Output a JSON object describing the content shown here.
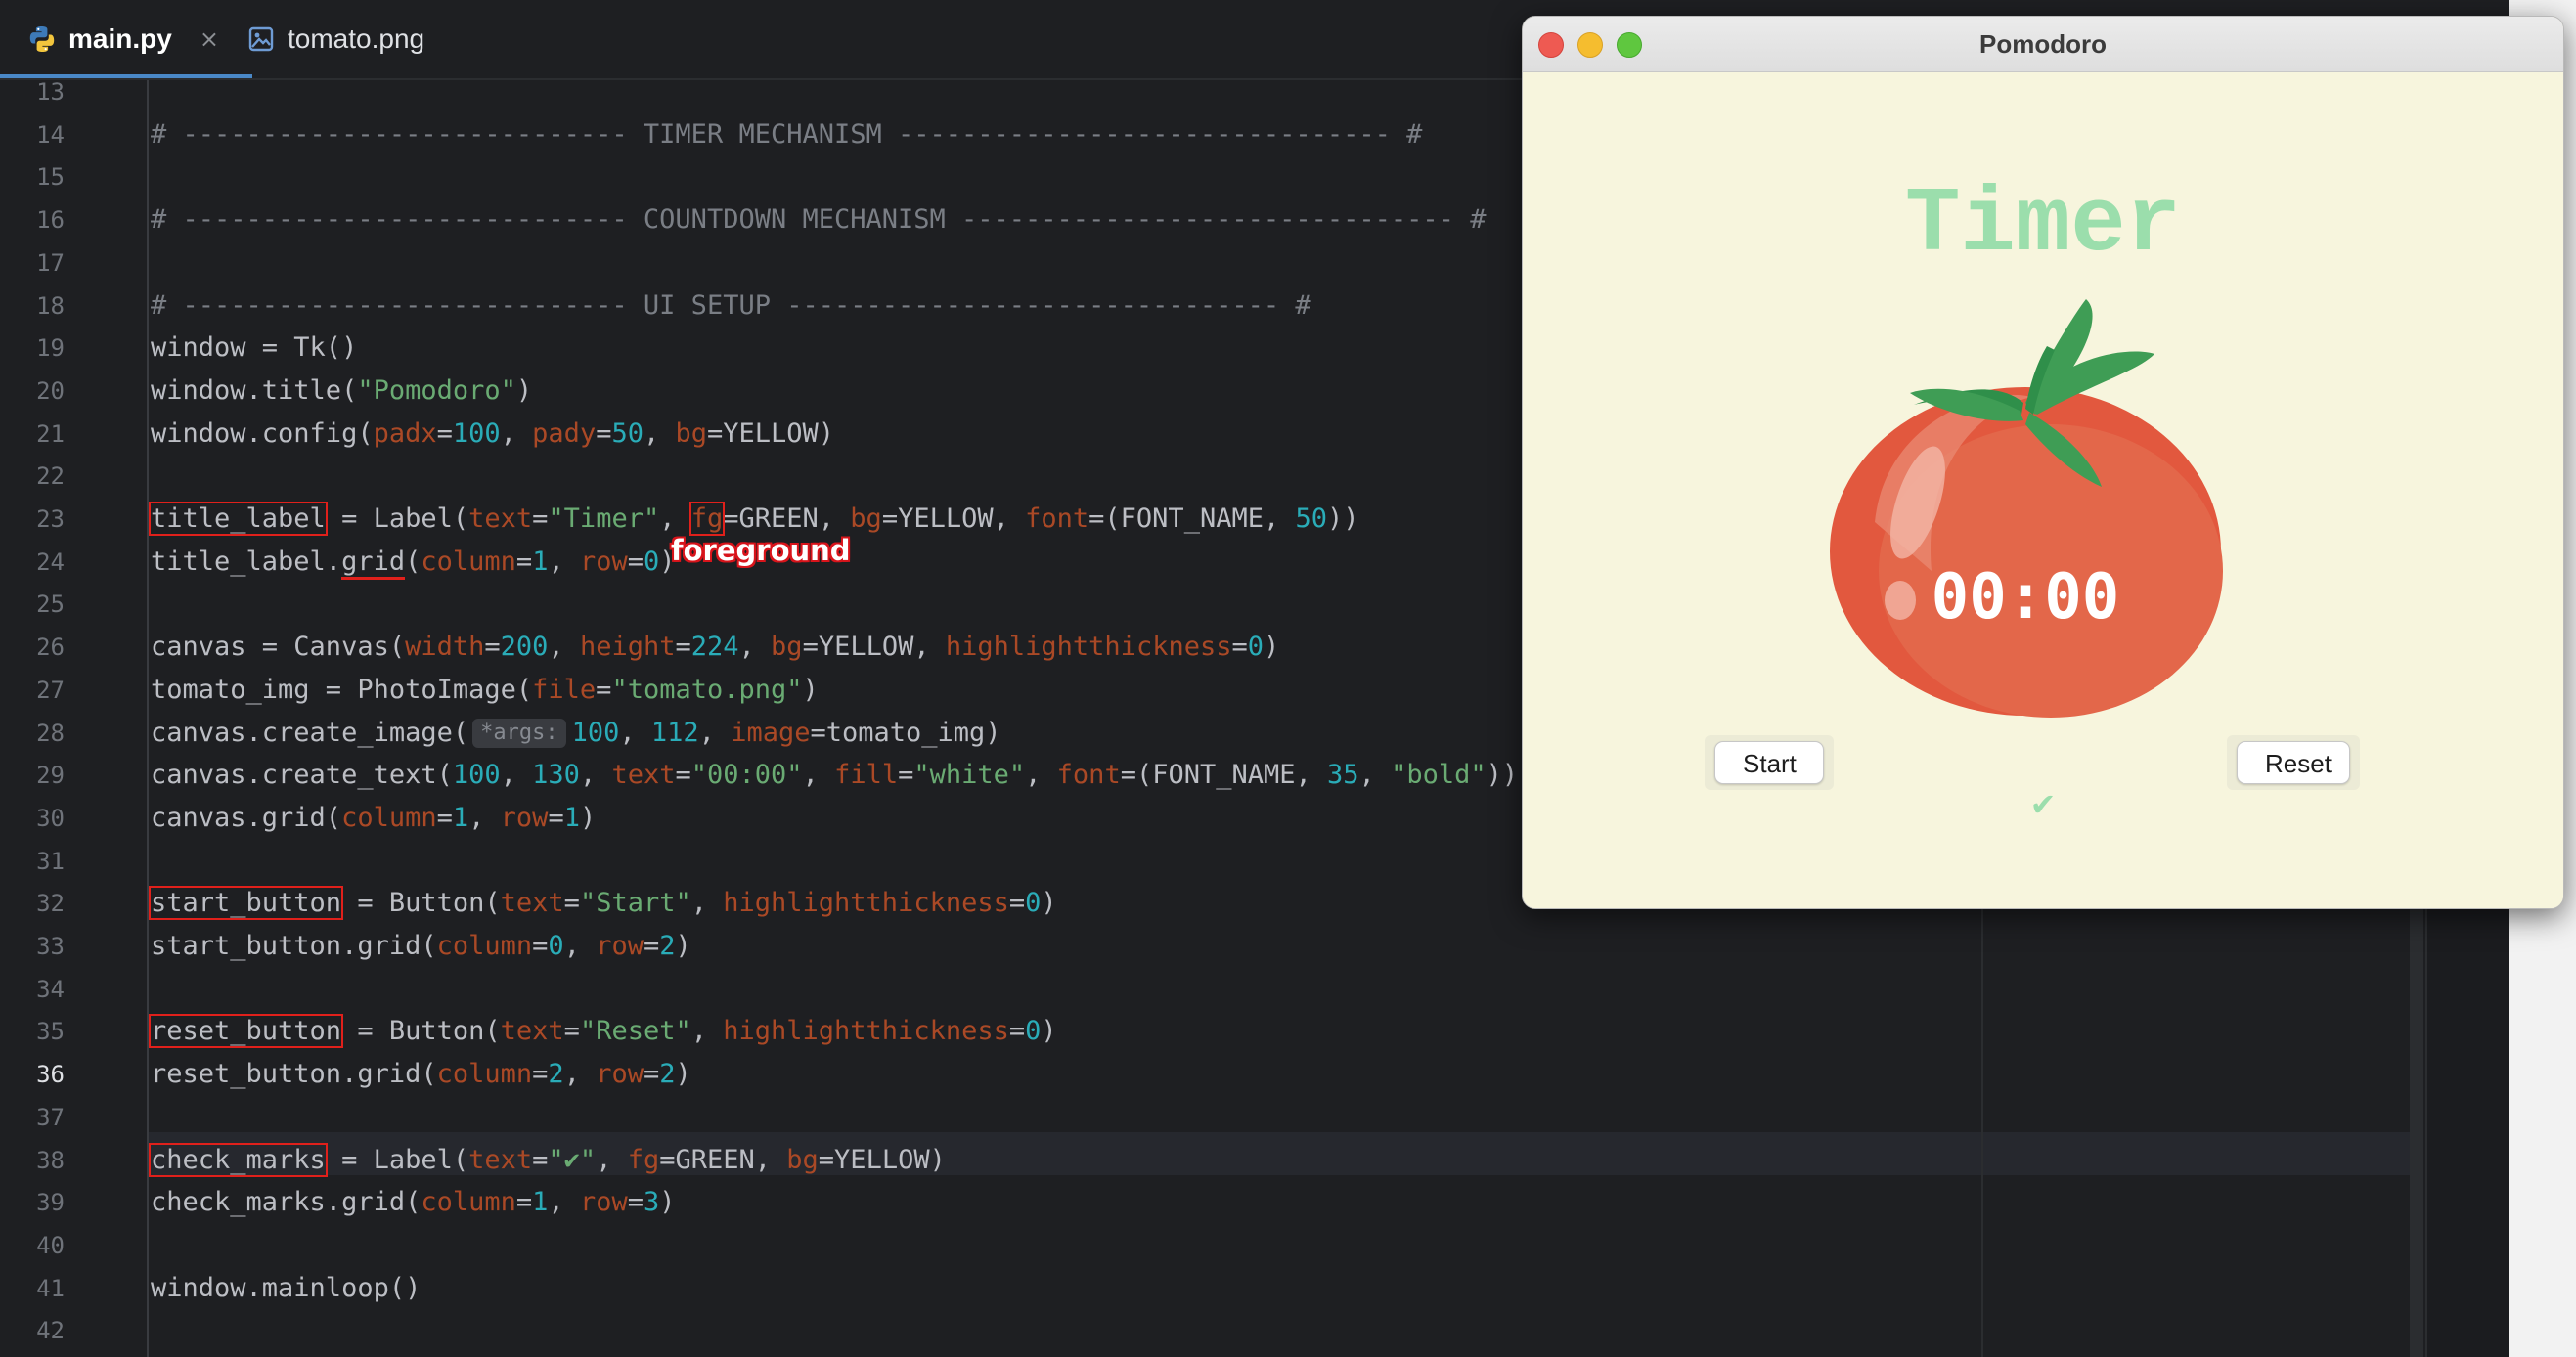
{
  "tabs": [
    {
      "label": "main.py",
      "icon": "python-icon",
      "active": true,
      "close": "×"
    },
    {
      "label": "tomato.png",
      "icon": "image-icon",
      "active": false
    }
  ],
  "editor": {
    "current_line": "36",
    "annotation": "foreground",
    "lines": [
      {
        "n": "13",
        "tokens": []
      },
      {
        "n": "14",
        "tokens": [
          {
            "t": "# ---------------------------- TIMER MECHANISM ------------------------------- #",
            "c": "com"
          }
        ]
      },
      {
        "n": "15",
        "tokens": []
      },
      {
        "n": "16",
        "tokens": [
          {
            "t": "# ---------------------------- COUNTDOWN MECHANISM ------------------------------- #",
            "c": "com"
          }
        ]
      },
      {
        "n": "17",
        "tokens": []
      },
      {
        "n": "18",
        "tokens": [
          {
            "t": "# ---------------------------- UI SETUP ------------------------------- #",
            "c": "com"
          }
        ]
      },
      {
        "n": "19",
        "tokens": [
          {
            "t": "window = Tk()"
          }
        ]
      },
      {
        "n": "20",
        "tokens": [
          {
            "t": "window.title("
          },
          {
            "t": "\"Pomodoro\"",
            "c": "str"
          },
          {
            "t": ")"
          }
        ]
      },
      {
        "n": "21",
        "tokens": [
          {
            "t": "window.config("
          },
          {
            "t": "padx",
            "c": "par"
          },
          {
            "t": "="
          },
          {
            "t": "100",
            "c": "num"
          },
          {
            "t": ", "
          },
          {
            "t": "pady",
            "c": "par"
          },
          {
            "t": "="
          },
          {
            "t": "50",
            "c": "num"
          },
          {
            "t": ", "
          },
          {
            "t": "bg",
            "c": "par"
          },
          {
            "t": "=YELLOW)"
          }
        ]
      },
      {
        "n": "22",
        "tokens": []
      },
      {
        "n": "23",
        "tokens": [
          {
            "t": "title_label",
            "c": "box"
          },
          {
            "t": " = Label("
          },
          {
            "t": "text",
            "c": "par"
          },
          {
            "t": "="
          },
          {
            "t": "\"Timer\"",
            "c": "str"
          },
          {
            "t": ", "
          },
          {
            "t": "fg",
            "c": "par box"
          },
          {
            "t": "=GREEN, "
          },
          {
            "t": "bg",
            "c": "par"
          },
          {
            "t": "=YELLOW, "
          },
          {
            "t": "font",
            "c": "par"
          },
          {
            "t": "=(FONT_NAME, "
          },
          {
            "t": "50",
            "c": "num"
          },
          {
            "t": "))"
          }
        ]
      },
      {
        "n": "24",
        "tokens": [
          {
            "t": "title_label."
          },
          {
            "t": "grid",
            "c": "under"
          },
          {
            "t": "("
          },
          {
            "t": "column",
            "c": "par"
          },
          {
            "t": "="
          },
          {
            "t": "1",
            "c": "num"
          },
          {
            "t": ", "
          },
          {
            "t": "row",
            "c": "par"
          },
          {
            "t": "="
          },
          {
            "t": "0",
            "c": "num"
          },
          {
            "t": ")"
          }
        ]
      },
      {
        "n": "25",
        "tokens": []
      },
      {
        "n": "26",
        "tokens": [
          {
            "t": "canvas = Canvas("
          },
          {
            "t": "width",
            "c": "par"
          },
          {
            "t": "="
          },
          {
            "t": "200",
            "c": "num"
          },
          {
            "t": ", "
          },
          {
            "t": "height",
            "c": "par"
          },
          {
            "t": "="
          },
          {
            "t": "224",
            "c": "num"
          },
          {
            "t": ", "
          },
          {
            "t": "bg",
            "c": "par"
          },
          {
            "t": "=YELLOW, "
          },
          {
            "t": "highlightthickness",
            "c": "par"
          },
          {
            "t": "="
          },
          {
            "t": "0",
            "c": "num"
          },
          {
            "t": ")"
          }
        ]
      },
      {
        "n": "27",
        "tokens": [
          {
            "t": "tomato_img = PhotoImage("
          },
          {
            "t": "file",
            "c": "par"
          },
          {
            "t": "="
          },
          {
            "t": "\"tomato.png\"",
            "c": "str"
          },
          {
            "t": ")"
          }
        ]
      },
      {
        "n": "28",
        "tokens": [
          {
            "t": "canvas.create_image("
          },
          {
            "t": "*args:",
            "c": "hint"
          },
          {
            "t": "100",
            "c": "num"
          },
          {
            "t": ", "
          },
          {
            "t": "112",
            "c": "num"
          },
          {
            "t": ", "
          },
          {
            "t": "image",
            "c": "par"
          },
          {
            "t": "=tomato_img)"
          }
        ]
      },
      {
        "n": "29",
        "tokens": [
          {
            "t": "canvas.create_text("
          },
          {
            "t": "100",
            "c": "num"
          },
          {
            "t": ", "
          },
          {
            "t": "130",
            "c": "num"
          },
          {
            "t": ", "
          },
          {
            "t": "text",
            "c": "par"
          },
          {
            "t": "="
          },
          {
            "t": "\"00:00\"",
            "c": "str"
          },
          {
            "t": ", "
          },
          {
            "t": "fill",
            "c": "par"
          },
          {
            "t": "="
          },
          {
            "t": "\"white\"",
            "c": "str"
          },
          {
            "t": ", "
          },
          {
            "t": "font",
            "c": "par"
          },
          {
            "t": "=(FONT_NAME, "
          },
          {
            "t": "35",
            "c": "num"
          },
          {
            "t": ", "
          },
          {
            "t": "\"bold\"",
            "c": "str"
          },
          {
            "t": "))"
          }
        ]
      },
      {
        "n": "30",
        "tokens": [
          {
            "t": "canvas.grid("
          },
          {
            "t": "column",
            "c": "par"
          },
          {
            "t": "="
          },
          {
            "t": "1",
            "c": "num"
          },
          {
            "t": ", "
          },
          {
            "t": "row",
            "c": "par"
          },
          {
            "t": "="
          },
          {
            "t": "1",
            "c": "num"
          },
          {
            "t": ")"
          }
        ]
      },
      {
        "n": "31",
        "tokens": []
      },
      {
        "n": "32",
        "tokens": [
          {
            "t": "start_button",
            "c": "box"
          },
          {
            "t": " = Button("
          },
          {
            "t": "text",
            "c": "par"
          },
          {
            "t": "="
          },
          {
            "t": "\"Start\"",
            "c": "str"
          },
          {
            "t": ", "
          },
          {
            "t": "highlightthickness",
            "c": "par"
          },
          {
            "t": "="
          },
          {
            "t": "0",
            "c": "num"
          },
          {
            "t": ")"
          }
        ]
      },
      {
        "n": "33",
        "tokens": [
          {
            "t": "start_button.grid("
          },
          {
            "t": "column",
            "c": "par"
          },
          {
            "t": "="
          },
          {
            "t": "0",
            "c": "num"
          },
          {
            "t": ", "
          },
          {
            "t": "row",
            "c": "par"
          },
          {
            "t": "="
          },
          {
            "t": "2",
            "c": "num"
          },
          {
            "t": ")"
          }
        ]
      },
      {
        "n": "34",
        "tokens": []
      },
      {
        "n": "35",
        "tokens": [
          {
            "t": "reset_button",
            "c": "box"
          },
          {
            "t": " = Button("
          },
          {
            "t": "text",
            "c": "par"
          },
          {
            "t": "="
          },
          {
            "t": "\"Reset\"",
            "c": "str"
          },
          {
            "t": ", "
          },
          {
            "t": "highlightthickness",
            "c": "par"
          },
          {
            "t": "="
          },
          {
            "t": "0",
            "c": "num"
          },
          {
            "t": ")"
          }
        ]
      },
      {
        "n": "36",
        "tokens": [
          {
            "t": "reset_button.grid("
          },
          {
            "t": "column",
            "c": "par"
          },
          {
            "t": "="
          },
          {
            "t": "2",
            "c": "num"
          },
          {
            "t": ", "
          },
          {
            "t": "row",
            "c": "par"
          },
          {
            "t": "="
          },
          {
            "t": "2",
            "c": "num"
          },
          {
            "t": ")"
          }
        ]
      },
      {
        "n": "37",
        "tokens": []
      },
      {
        "n": "38",
        "tokens": [
          {
            "t": "check_marks",
            "c": "box"
          },
          {
            "t": " = Label("
          },
          {
            "t": "text",
            "c": "par"
          },
          {
            "t": "="
          },
          {
            "t": "\"✔\"",
            "c": "str"
          },
          {
            "t": ", "
          },
          {
            "t": "fg",
            "c": "par"
          },
          {
            "t": "=GREEN, "
          },
          {
            "t": "bg",
            "c": "par"
          },
          {
            "t": "=YELLOW)"
          }
        ]
      },
      {
        "n": "39",
        "tokens": [
          {
            "t": "check_marks.grid("
          },
          {
            "t": "column",
            "c": "par"
          },
          {
            "t": "="
          },
          {
            "t": "1",
            "c": "num"
          },
          {
            "t": ", "
          },
          {
            "t": "row",
            "c": "par"
          },
          {
            "t": "="
          },
          {
            "t": "3",
            "c": "num"
          },
          {
            "t": ")"
          }
        ]
      },
      {
        "n": "40",
        "tokens": []
      },
      {
        "n": "41",
        "tokens": [
          {
            "t": "window.mainloop()"
          }
        ]
      },
      {
        "n": "42",
        "tokens": []
      }
    ]
  },
  "app_window": {
    "title": "Pomodoro",
    "heading": "Timer",
    "timer_text": "00:00",
    "start_label": "Start",
    "reset_label": "Reset",
    "check_mark": "✔",
    "colors": {
      "background": "#f7f5dd",
      "green": "#9bdeac",
      "tomato": "#e2583e"
    }
  }
}
